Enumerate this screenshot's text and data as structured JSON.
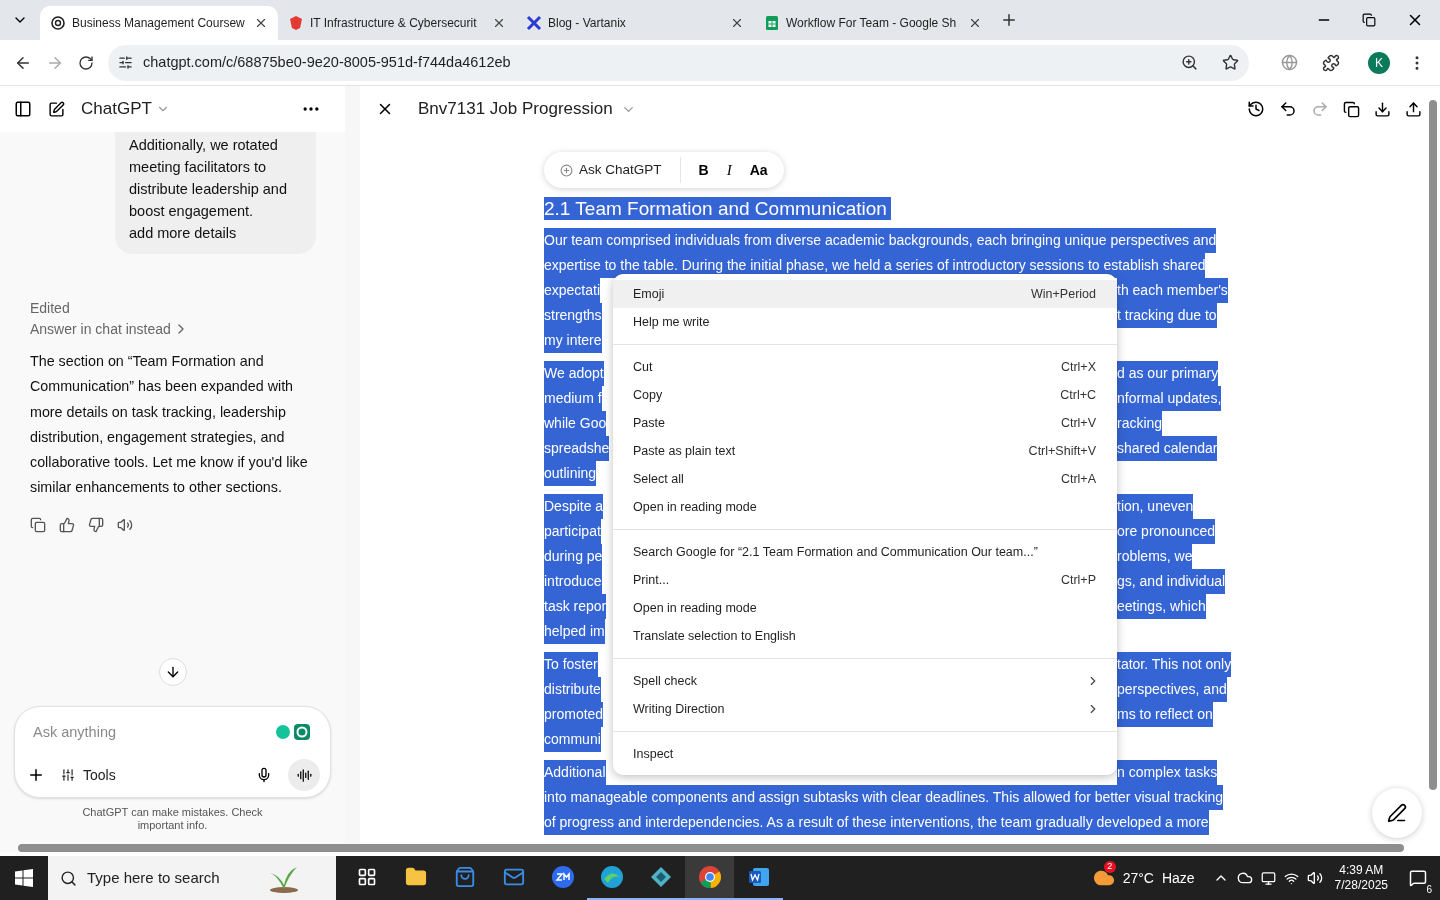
{
  "browser": {
    "tabs": [
      {
        "title": "Business Management Coursew",
        "selected": true
      },
      {
        "title": "IT Infrastructure & Cybersecurit",
        "selected": false
      },
      {
        "title": "Blog - Vartanix",
        "selected": false
      },
      {
        "title": "Workflow For Team - Google Sh",
        "selected": false
      }
    ],
    "url": "chatgpt.com/c/68875be0-9e20-8005-951d-f744da4612eb",
    "profile": "K"
  },
  "sidebar": {
    "title": "ChatGPT",
    "user_message": [
      "Additionally, we rotated meeting facilitators to distribute leadership and boost engagement.",
      "add more details"
    ],
    "status": "Edited",
    "answer_link": "Answer in chat instead",
    "reply": "The section on “Team Formation and Communication” has been expanded with more details on task tracking, leadership distribution, engagement strategies, and collaborative tools. Let me know if you'd like similar enhancements to other sections.",
    "composer": {
      "placeholder": "Ask anything",
      "tools": "Tools"
    },
    "disclaimer": "ChatGPT can make mistakes. Check important info."
  },
  "editor": {
    "title": "Bnv7131 Job Progression",
    "toolbar": {
      "ask": "Ask ChatGPT",
      "bold": "B",
      "italic": "I",
      "size": "Aa"
    },
    "heading": "2.1 Team Formation and Communication",
    "paragraphs": [
      [
        {
          "text": "Our team comprised individuals from diverse academic backgrounds, each bringing unique perspectives and"
        },
        {
          "text": "expertise to the table. During the initial phase, we held a series of introductory sessions to establish shared"
        },
        {
          "left": "expectati",
          "right": "th each member's"
        },
        {
          "left": "strengths",
          "right": "t tracking due to"
        },
        {
          "left": "my intere"
        }
      ],
      [
        {
          "left": "We adopt",
          "right": "d as our primary"
        },
        {
          "left": "medium f",
          "right": "nformal updates,"
        },
        {
          "left": "while Goo",
          "right": "racking"
        },
        {
          "left": "spreadshe",
          "right": "shared calendar"
        },
        {
          "left": "outlining"
        }
      ],
      [
        {
          "left": "Despite a",
          "right": "tion, uneven"
        },
        {
          "left": "participat",
          "right": "ore pronounced"
        },
        {
          "left": "during pe",
          "right": "roblems, we"
        },
        {
          "left": "introduce",
          "right": "gs, and individual"
        },
        {
          "left": "task repor",
          "right": "eetings, which"
        },
        {
          "left": "helped im"
        }
      ],
      [
        {
          "left": "To foster",
          "right": "tator. This not only"
        },
        {
          "left": "distribute",
          "right": "perspectives, and"
        },
        {
          "left": "promoted",
          "right": "ms to reflect on"
        },
        {
          "left": "communi"
        }
      ],
      [
        {
          "left": "Additional",
          "right": "n complex tasks"
        },
        {
          "text": "into manageable components and assign subtasks with clear deadlines. This allowed for better visual tracking"
        },
        {
          "text": "of progress and interdependencies. As a result of these interventions, the team gradually developed a more"
        }
      ]
    ]
  },
  "context_menu": [
    [
      {
        "label": "Emoji",
        "shortcut": "Win+Period",
        "highlighted": true,
        "submenu": false
      },
      {
        "label": "Help me write",
        "highlighted": false,
        "submenu": false
      }
    ],
    [
      {
        "label": "Cut",
        "shortcut": "Ctrl+X",
        "highlighted": false,
        "submenu": false
      },
      {
        "label": "Copy",
        "shortcut": "Ctrl+C",
        "highlighted": false,
        "submenu": false
      },
      {
        "label": "Paste",
        "shortcut": "Ctrl+V",
        "highlighted": false,
        "submenu": false
      },
      {
        "label": "Paste as plain text",
        "shortcut": "Ctrl+Shift+V",
        "highlighted": false,
        "submenu": false
      },
      {
        "label": "Select all",
        "shortcut": "Ctrl+A",
        "highlighted": false,
        "submenu": false
      },
      {
        "label": "Open in reading mode",
        "highlighted": false,
        "submenu": false
      }
    ],
    [
      {
        "label": "Search Google for “2.1 Team Formation and Communication Our team...”",
        "highlighted": false,
        "submenu": false
      },
      {
        "label": "Print...",
        "shortcut": "Ctrl+P",
        "highlighted": false,
        "submenu": false
      },
      {
        "label": "Open in reading mode",
        "highlighted": false,
        "submenu": false
      },
      {
        "label": "Translate selection to English",
        "highlighted": false,
        "submenu": false
      }
    ],
    [
      {
        "label": "Spell check",
        "highlighted": false,
        "submenu": true
      },
      {
        "label": "Writing Direction",
        "highlighted": false,
        "submenu": true
      }
    ],
    [
      {
        "label": "Inspect",
        "highlighted": false,
        "submenu": false
      }
    ]
  ],
  "taskbar": {
    "search_placeholder": "Type here to search",
    "apps": [
      {
        "running": false,
        "selected": false
      },
      {
        "running": false,
        "selected": false
      },
      {
        "running": false,
        "selected": false
      },
      {
        "running": false,
        "selected": false
      },
      {
        "running": false,
        "selected": false
      },
      {
        "running": true,
        "selected": false
      },
      {
        "running": true,
        "selected": false
      },
      {
        "running": true,
        "selected": true
      },
      {
        "running": true,
        "selected": false
      }
    ],
    "weather_badge": "2",
    "temperature": "27°C",
    "condition": "Haze",
    "time": "4:39 AM",
    "date": "7/28/2025",
    "notifications": "6"
  }
}
